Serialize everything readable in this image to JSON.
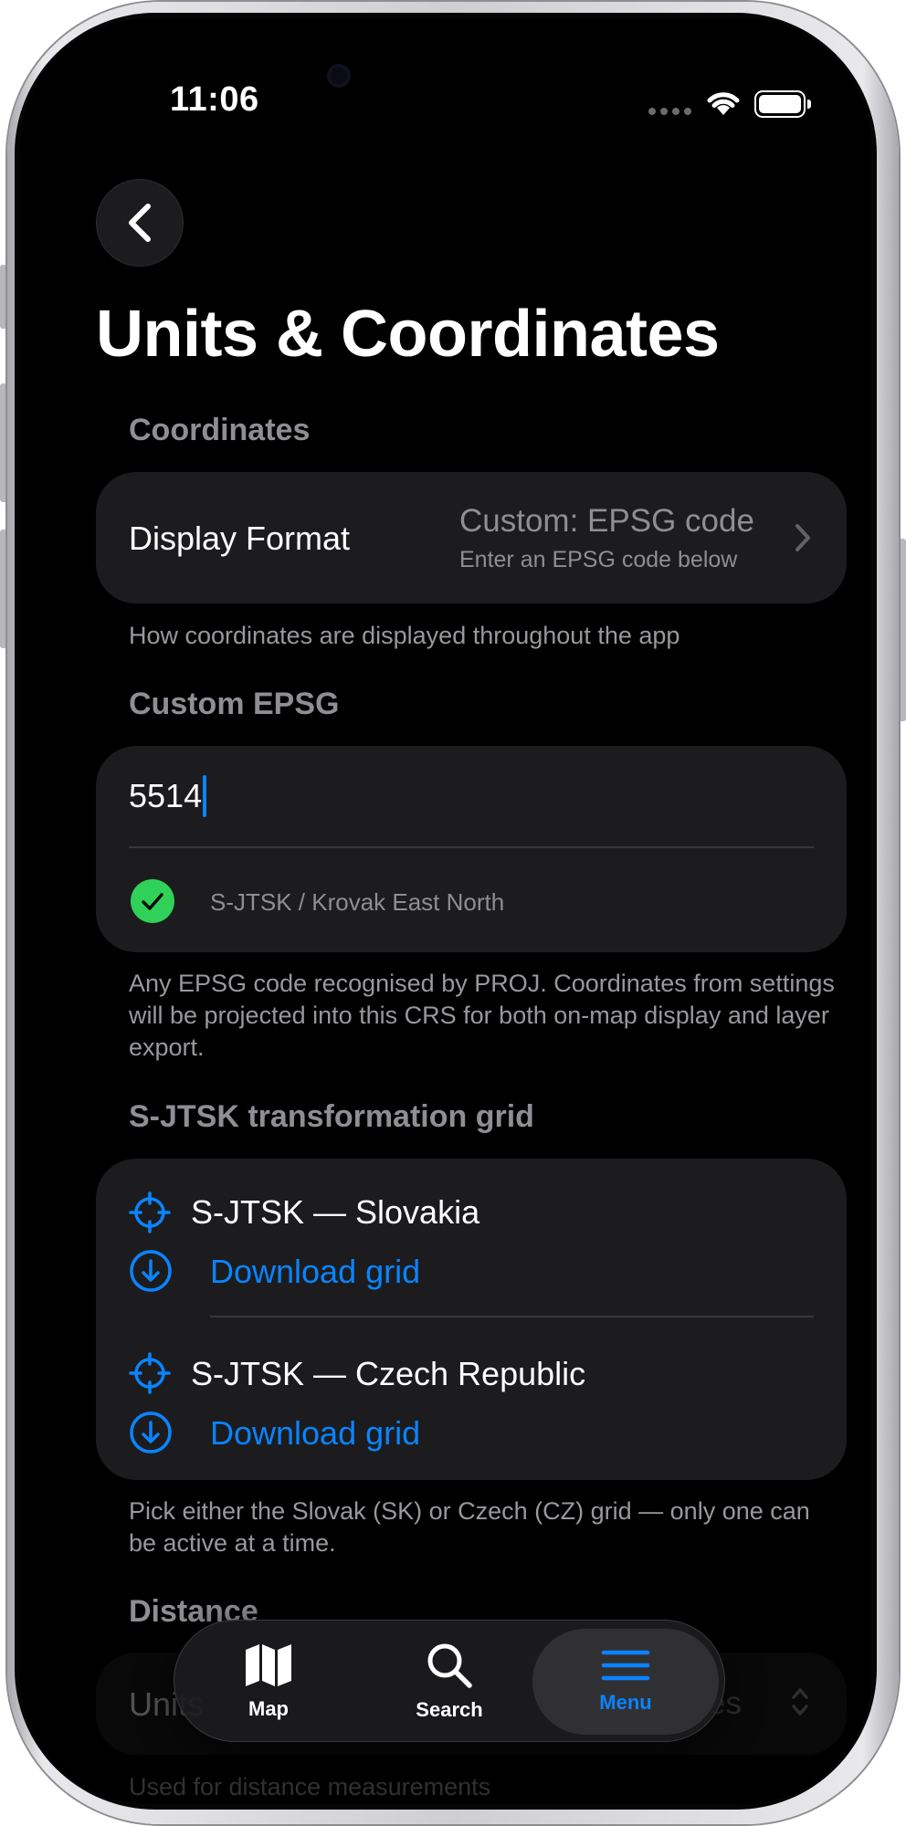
{
  "status_bar": {
    "time": "11:06"
  },
  "page": {
    "title": "Units & Coordinates"
  },
  "coordinates": {
    "header": "Coordinates",
    "display_format": {
      "label": "Display Format",
      "value": "Custom: EPSG code",
      "subtitle": "Enter an EPSG code below"
    },
    "footnote": "How coordinates are displayed throughout the app"
  },
  "custom_epsg": {
    "header": "Custom EPSG",
    "input_value": "5514",
    "validation_text": "S-JTSK / Krovak East North",
    "footnote": "Any EPSG code recognised by PROJ. Coordinates from settings will be projected into this CRS for both on-map display and layer export."
  },
  "transformation_grid": {
    "header": "S-JTSK transformation grid",
    "items": [
      {
        "name": "S-JTSK — Slovakia",
        "action": "Download grid"
      },
      {
        "name": "S-JTSK — Czech Republic",
        "action": "Download grid"
      }
    ],
    "footnote": "Pick either the Slovak (SK) or Czech (CZ) grid — only one can be active at a time."
  },
  "distance": {
    "header": "Distance",
    "units_label": "Units",
    "units_value": "Metres",
    "footnote": "Used for distance measurements"
  },
  "tab_bar": {
    "tabs": [
      {
        "label": "Map",
        "icon": "map-icon"
      },
      {
        "label": "Search",
        "icon": "search-icon"
      },
      {
        "label": "Menu",
        "icon": "menu-icon",
        "active": true
      }
    ]
  },
  "colors": {
    "accent": "#0a84ff",
    "success": "#30d158",
    "background": "#000000",
    "card": "#1c1c1e"
  }
}
